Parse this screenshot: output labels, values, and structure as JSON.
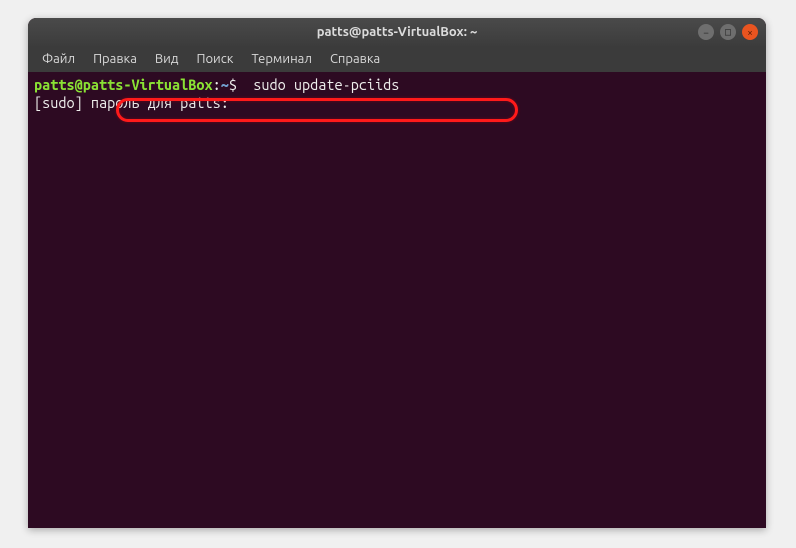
{
  "window": {
    "title": "patts@patts-VirtualBox: ~"
  },
  "menu": {
    "file": "Файл",
    "edit": "Правка",
    "view": "Вид",
    "search": "Поиск",
    "terminal": "Терминал",
    "help": "Справка"
  },
  "terminal": {
    "prompt_user_host": "patts@patts-VirtualBox",
    "prompt_colon": ":",
    "prompt_path": "~",
    "prompt_symbol": "$",
    "command": "  sudo update-pciids",
    "sudo_prefix": "[sudo] ",
    "sudo_prompt": "пароль для patts: "
  },
  "controls": {
    "minimize": "−",
    "maximize": "□",
    "close": "×"
  }
}
